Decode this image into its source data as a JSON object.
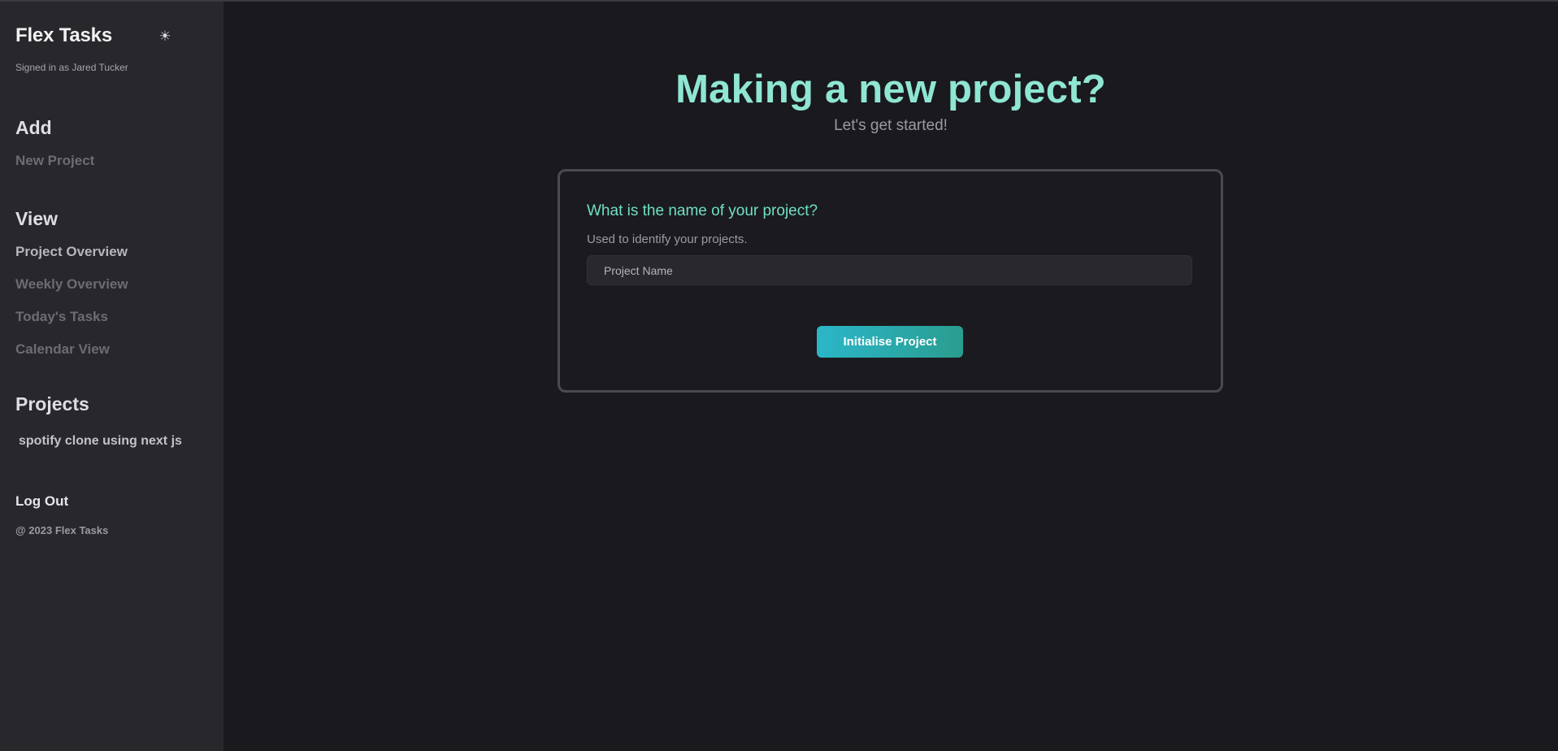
{
  "sidebar": {
    "brand": "Flex Tasks",
    "theme_icon": "sun-icon",
    "signed_in": "Signed in as Jared Tucker",
    "add_heading": "Add",
    "add_items": [
      "New Project"
    ],
    "view_heading": "View",
    "view_items": [
      "Project Overview",
      "Weekly Overview",
      "Today's Tasks",
      "Calendar View"
    ],
    "projects_heading": "Projects",
    "projects": [
      "spotify clone using next js"
    ],
    "logout": "Log Out",
    "copyright": "@ 2023 Flex Tasks"
  },
  "main": {
    "title": "Making a new project?",
    "subtitle": "Let's get started!",
    "form": {
      "question": "What is the name of your project?",
      "helper": "Used to identify your projects.",
      "input_placeholder": "Project Name",
      "input_value": "",
      "submit_label": "Initialise Project"
    }
  },
  "colors": {
    "accent": "#8fe6d2",
    "question": "#6ee0c3",
    "button_gradient_start": "#2bb6c9",
    "button_gradient_end": "#2a9d8f",
    "background": "#1a191e",
    "sidebar_background": "#27272c"
  }
}
